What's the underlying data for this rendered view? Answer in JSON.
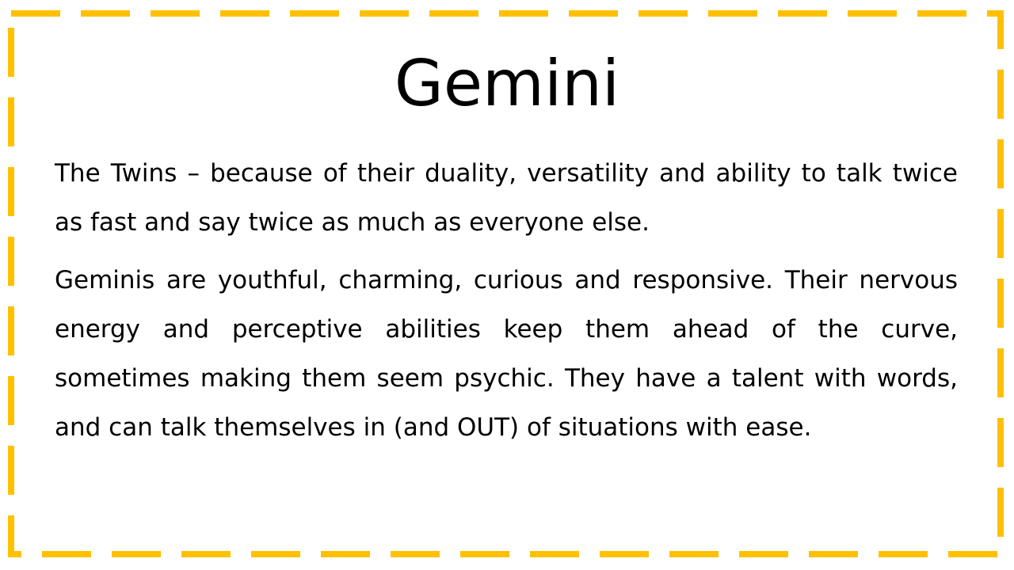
{
  "slide": {
    "title": "Gemini",
    "paragraphs": [
      "The Twins – because of their duality, versatility and ability to talk twice as fast and say twice as much as everyone else.",
      "Geminis are youthful, charming, curious and responsive. Their nervous energy and perceptive abilities keep them ahead of the curve, sometimes making them seem psychic. They have a talent with words, and can talk themselves in (and OUT) of situations with ease."
    ]
  },
  "colors": {
    "border": "#FFC000",
    "text": "#000000",
    "background": "#FFFFFF"
  }
}
